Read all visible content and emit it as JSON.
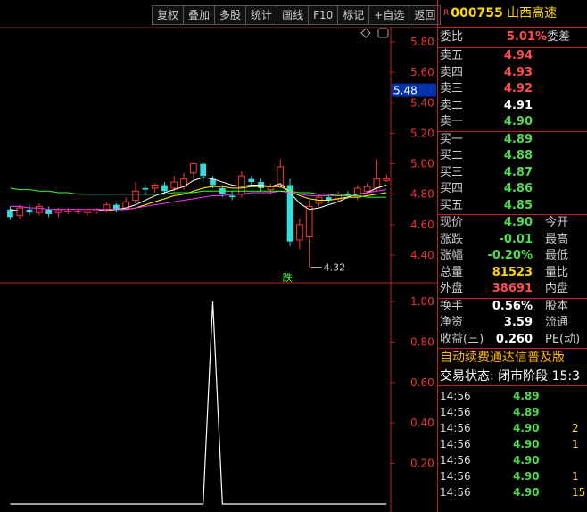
{
  "toolbar": {
    "buttons": [
      "复权",
      "叠加",
      "多股",
      "统计",
      "画线",
      "F10",
      "标记",
      "+自选",
      "返回"
    ]
  },
  "stock": {
    "badge": "R",
    "code": "000755",
    "name": "山西高速"
  },
  "order_ratio": {
    "label": "委比",
    "value": "5.01%",
    "label2": "委差"
  },
  "asks": [
    {
      "label": "卖五",
      "price": "4.94",
      "color": "red"
    },
    {
      "label": "卖四",
      "price": "4.93",
      "color": "red"
    },
    {
      "label": "卖三",
      "price": "4.92",
      "color": "red"
    },
    {
      "label": "卖二",
      "price": "4.91",
      "color": "white"
    },
    {
      "label": "卖一",
      "price": "4.90",
      "color": "green"
    }
  ],
  "bids": [
    {
      "label": "买一",
      "price": "4.89",
      "color": "green"
    },
    {
      "label": "买二",
      "price": "4.88",
      "color": "green"
    },
    {
      "label": "买三",
      "price": "4.87",
      "color": "green"
    },
    {
      "label": "买四",
      "price": "4.86",
      "color": "green"
    },
    {
      "label": "买五",
      "price": "4.85",
      "color": "green"
    }
  ],
  "quote": [
    {
      "label": "现价",
      "value": "4.90",
      "color": "green",
      "label2": "今开"
    },
    {
      "label": "涨跌",
      "value": "-0.01",
      "color": "green",
      "label2": "最高"
    },
    {
      "label": "涨幅",
      "value": "-0.20%",
      "color": "green",
      "label2": "最低"
    },
    {
      "label": "总量",
      "value": "81523",
      "color": "yellow",
      "label2": "量比"
    },
    {
      "label": "外盘",
      "value": "38691",
      "color": "red",
      "label2": "内盘"
    }
  ],
  "stats": [
    {
      "label": "换手",
      "value": "0.56%",
      "label2": "股本"
    },
    {
      "label": "净资",
      "value": "3.59",
      "label2": "流通"
    },
    {
      "label": "收益(三)",
      "value": "0.260",
      "label2": "PE(动)"
    }
  ],
  "promo": "自动续费通达信普及版",
  "trade_status": "交易状态: 闭市阶段 15:3",
  "ticks": [
    {
      "time": "14:56",
      "price": "4.89",
      "vol": ""
    },
    {
      "time": "14:56",
      "price": "4.89",
      "vol": ""
    },
    {
      "time": "14:56",
      "price": "4.90",
      "vol": "2"
    },
    {
      "time": "14:56",
      "price": "4.90",
      "vol": "1"
    },
    {
      "time": "14:56",
      "price": "4.90",
      "vol": ""
    },
    {
      "time": "14:56",
      "price": "4.90",
      "vol": "1"
    },
    {
      "time": "14:56",
      "price": "4.90",
      "vol": "15"
    }
  ],
  "chart_data": [
    {
      "type": "candlestick",
      "y_ticks": [
        "5.80",
        "5.60",
        "5.40",
        "5.20",
        "5.00",
        "4.80",
        "4.60",
        "4.40"
      ],
      "current_price_label": "5.48",
      "min_label": "4.32",
      "annotation": "跌",
      "candles": [
        {
          "o": 4.7,
          "c": 4.65,
          "h": 4.72,
          "l": 4.63
        },
        {
          "o": 4.66,
          "c": 4.71,
          "h": 4.73,
          "l": 4.64
        },
        {
          "o": 4.7,
          "c": 4.68,
          "h": 4.73,
          "l": 4.66
        },
        {
          "o": 4.68,
          "c": 4.72,
          "h": 4.74,
          "l": 4.66
        },
        {
          "o": 4.7,
          "c": 4.67,
          "h": 4.72,
          "l": 4.65
        },
        {
          "o": 4.68,
          "c": 4.7,
          "h": 4.71,
          "l": 4.65
        },
        {
          "o": 4.69,
          "c": 4.69,
          "h": 4.71,
          "l": 4.67
        },
        {
          "o": 4.69,
          "c": 4.69,
          "h": 4.7,
          "l": 4.67
        },
        {
          "o": 4.68,
          "c": 4.69,
          "h": 4.7,
          "l": 4.66
        },
        {
          "o": 4.69,
          "c": 4.7,
          "h": 4.71,
          "l": 4.67
        },
        {
          "o": 4.7,
          "c": 4.73,
          "h": 4.75,
          "l": 4.68
        },
        {
          "o": 4.73,
          "c": 4.7,
          "h": 4.74,
          "l": 4.68
        },
        {
          "o": 4.71,
          "c": 4.75,
          "h": 4.78,
          "l": 4.7
        },
        {
          "o": 4.76,
          "c": 4.82,
          "h": 4.88,
          "l": 4.74
        },
        {
          "o": 4.84,
          "c": 4.83,
          "h": 4.86,
          "l": 4.8
        },
        {
          "o": 4.84,
          "c": 4.86,
          "h": 4.87,
          "l": 4.81
        },
        {
          "o": 4.86,
          "c": 4.82,
          "h": 4.88,
          "l": 4.8
        },
        {
          "o": 4.84,
          "c": 4.88,
          "h": 4.92,
          "l": 4.82
        },
        {
          "o": 4.85,
          "c": 4.9,
          "h": 4.94,
          "l": 4.83
        },
        {
          "o": 4.94,
          "c": 5.0,
          "h": 5.0,
          "l": 4.9
        },
        {
          "o": 5.0,
          "c": 4.92,
          "h": 5.01,
          "l": 4.88
        },
        {
          "o": 4.9,
          "c": 4.86,
          "h": 4.92,
          "l": 4.84
        },
        {
          "o": 4.84,
          "c": 4.8,
          "h": 4.86,
          "l": 4.78
        },
        {
          "o": 4.79,
          "c": 4.78,
          "h": 4.82,
          "l": 4.76
        },
        {
          "o": 4.8,
          "c": 4.92,
          "h": 4.95,
          "l": 4.78
        },
        {
          "o": 4.9,
          "c": 4.88,
          "h": 4.92,
          "l": 4.86
        },
        {
          "o": 4.88,
          "c": 4.84,
          "h": 4.9,
          "l": 4.82
        },
        {
          "o": 4.83,
          "c": 4.85,
          "h": 4.87,
          "l": 4.8
        },
        {
          "o": 4.86,
          "c": 4.98,
          "h": 5.03,
          "l": 4.84
        },
        {
          "o": 4.86,
          "c": 4.49,
          "h": 4.9,
          "l": 4.46
        },
        {
          "o": 4.5,
          "c": 4.6,
          "h": 4.64,
          "l": 4.44
        },
        {
          "o": 4.52,
          "c": 4.72,
          "h": 4.76,
          "l": 4.32
        },
        {
          "o": 4.74,
          "c": 4.78,
          "h": 4.8,
          "l": 4.72
        },
        {
          "o": 4.78,
          "c": 4.76,
          "h": 4.8,
          "l": 4.74
        },
        {
          "o": 4.77,
          "c": 4.8,
          "h": 4.82,
          "l": 4.75
        },
        {
          "o": 4.8,
          "c": 4.79,
          "h": 4.82,
          "l": 4.77
        },
        {
          "o": 4.78,
          "c": 4.84,
          "h": 4.86,
          "l": 4.76
        },
        {
          "o": 4.82,
          "c": 4.85,
          "h": 4.87,
          "l": 4.8
        },
        {
          "o": 4.84,
          "c": 4.9,
          "h": 5.03,
          "l": 4.82
        },
        {
          "o": 4.89,
          "c": 4.9,
          "h": 4.93,
          "l": 4.88
        }
      ],
      "ma": [
        {
          "color": "#ffffff",
          "values": [
            4.7,
            4.69,
            4.69,
            4.69,
            4.69,
            4.69,
            4.69,
            4.69,
            4.69,
            4.69,
            4.7,
            4.7,
            4.71,
            4.73,
            4.76,
            4.79,
            4.81,
            4.83,
            4.85,
            4.89,
            4.91,
            4.9,
            4.88,
            4.86,
            4.85,
            4.86,
            4.86,
            4.85,
            4.87,
            4.81,
            4.74,
            4.7,
            4.71,
            4.73,
            4.75,
            4.78,
            4.8,
            4.81,
            4.84,
            4.86
          ]
        },
        {
          "color": "#ffff00",
          "values": [
            4.69,
            4.69,
            4.69,
            4.69,
            4.69,
            4.69,
            4.69,
            4.69,
            4.69,
            4.69,
            4.69,
            4.7,
            4.7,
            4.71,
            4.73,
            4.75,
            4.77,
            4.79,
            4.8,
            4.82,
            4.84,
            4.85,
            4.85,
            4.84,
            4.84,
            4.85,
            4.85,
            4.85,
            4.85,
            4.82,
            4.79,
            4.77,
            4.76,
            4.76,
            4.77,
            4.78,
            4.78,
            4.79,
            4.8,
            4.81
          ]
        },
        {
          "color": "#ff33ff",
          "values": [
            4.72,
            4.72,
            4.71,
            4.71,
            4.7,
            4.7,
            4.7,
            4.7,
            4.7,
            4.7,
            4.7,
            4.7,
            4.7,
            4.71,
            4.72,
            4.73,
            4.74,
            4.75,
            4.76,
            4.77,
            4.78,
            4.79,
            4.79,
            4.8,
            4.8,
            4.81,
            4.81,
            4.81,
            4.82,
            4.81,
            4.8,
            4.79,
            4.79,
            4.79,
            4.79,
            4.8,
            4.8,
            4.81,
            4.82,
            4.83
          ]
        },
        {
          "color": "#33ff33",
          "values": [
            4.84,
            4.83,
            4.83,
            4.82,
            4.82,
            4.81,
            4.81,
            4.8,
            4.8,
            4.8,
            4.8,
            4.8,
            4.8,
            4.8,
            4.8,
            4.8,
            4.8,
            4.81,
            4.81,
            4.81,
            4.82,
            4.82,
            4.82,
            4.82,
            4.82,
            4.82,
            4.82,
            4.82,
            4.82,
            4.82,
            4.81,
            4.81,
            4.8,
            4.8,
            4.79,
            4.79,
            4.79,
            4.78,
            4.78,
            4.78
          ]
        }
      ]
    },
    {
      "type": "line",
      "y_ticks": [
        "1.00",
        "0.80",
        "0.60",
        "0.40",
        "0.20"
      ],
      "ylim": [
        0,
        1
      ],
      "values": [
        0,
        0,
        0,
        0,
        0,
        0,
        0,
        0,
        0,
        0,
        0,
        0,
        0,
        0,
        0,
        0,
        0,
        0,
        0,
        0,
        0,
        1.0,
        0,
        0,
        0,
        0,
        0,
        0,
        0,
        0,
        0,
        0,
        0,
        0,
        0,
        0,
        0,
        0,
        0,
        0
      ]
    }
  ]
}
